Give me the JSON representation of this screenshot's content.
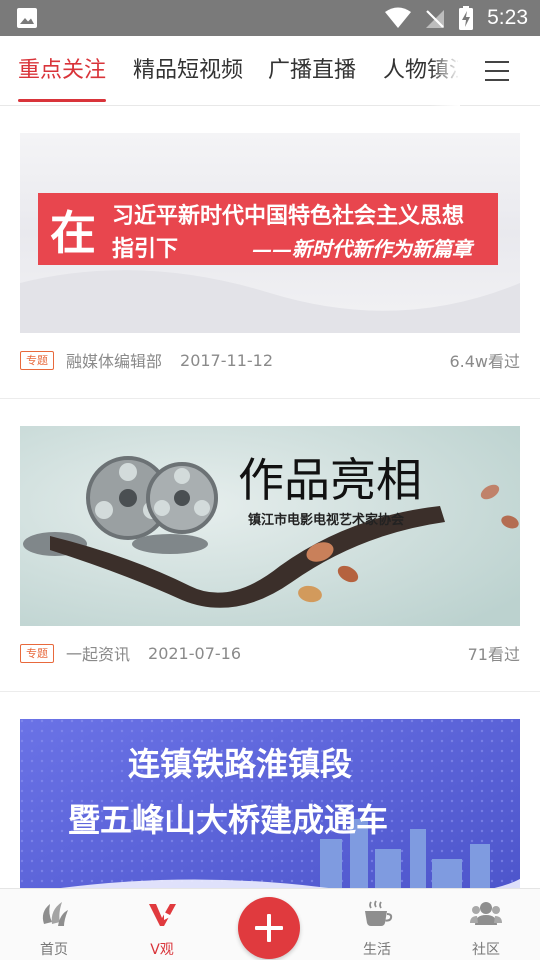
{
  "status_bar": {
    "time": "5:23",
    "icons": [
      "image-icon",
      "wifi-icon",
      "no-signal-icon",
      "battery-charging-icon"
    ]
  },
  "top_tabs": [
    {
      "label": "重点关注",
      "active": true
    },
    {
      "label": "精品短视频",
      "active": false
    },
    {
      "label": "广播直播",
      "active": false
    },
    {
      "label": "人物镇江",
      "active": false
    }
  ],
  "menu_icon": "menu-icon",
  "feed": [
    {
      "banner": {
        "line1": "习近平新时代中国特色社会主义思想",
        "big_char": "在",
        "line2": "指引下",
        "line3": "——新时代新作为新篇章",
        "accent_color": "#e8464e"
      },
      "tag": "专题",
      "source": "融媒体编辑部",
      "date": "2017-11-12",
      "views": "6.4w看过"
    },
    {
      "banner": {
        "title": "作品亮相",
        "subtitle": "镇江市电影电视艺术家协会",
        "bg_color": "#d3e2df"
      },
      "tag": "专题",
      "source": "一起资讯",
      "date": "2021-07-16",
      "views": "71看过"
    },
    {
      "banner": {
        "line1": "连镇铁路淮镇段",
        "line2": "暨五峰山大桥建成通车",
        "bg_color": "#5a63d8"
      }
    }
  ],
  "bottom_nav": [
    {
      "label": "首页",
      "icon": "home-logo-icon",
      "active": false
    },
    {
      "label": "V观",
      "icon": "v-watch-icon",
      "active": true
    },
    {
      "label": "",
      "icon": "plus-icon",
      "active": false
    },
    {
      "label": "生活",
      "icon": "coffee-cup-icon",
      "active": false
    },
    {
      "label": "社区",
      "icon": "community-people-icon",
      "active": false
    }
  ],
  "colors": {
    "accent": "#d9343a",
    "tag_border": "#e8693c",
    "status_bar_bg": "#7a7a7a"
  }
}
